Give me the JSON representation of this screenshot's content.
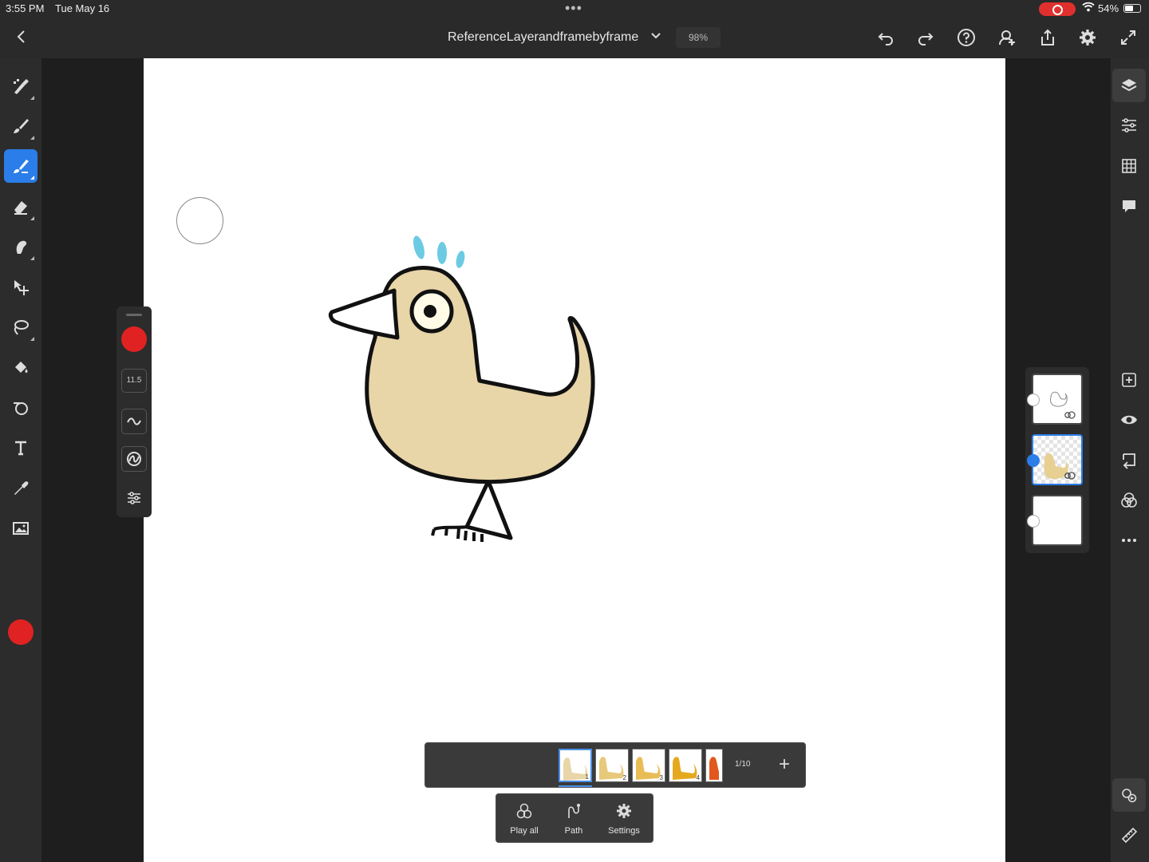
{
  "status_bar": {
    "time": "3:55 PM",
    "date": "Tue May 16",
    "battery": "54%"
  },
  "top_bar": {
    "document_title": "ReferenceLayerandframebyframe",
    "zoom": "98%",
    "icons": [
      "back-icon",
      "undo-icon",
      "redo-icon",
      "help-icon",
      "share-user-icon",
      "export-icon",
      "settings-icon",
      "fullscreen-icon"
    ]
  },
  "left_tools": {
    "items": [
      "pixel-brush",
      "live-brush",
      "vector-brush",
      "eraser",
      "smudge",
      "transform",
      "lasso-select",
      "fill",
      "liquify",
      "text",
      "eyedropper",
      "image"
    ],
    "active": "vector-brush",
    "current_color": "#e02222"
  },
  "brush_panel": {
    "size": "11.5",
    "color": "#e02222"
  },
  "right_tools": {
    "items": [
      "layers",
      "properties",
      "grid",
      "comments"
    ],
    "active": "layers",
    "layer_actions": [
      "add-layer",
      "visibility",
      "reference-layer",
      "blend-mode",
      "more"
    ],
    "bottom": [
      "animation",
      "ruler"
    ]
  },
  "layers": {
    "count": 3,
    "selected": 2
  },
  "timeline": {
    "frames": [
      "1",
      "2",
      "3",
      "4"
    ],
    "frame_counter": "1/10",
    "add_label": "+"
  },
  "animation_menu": {
    "play_all": "Play all",
    "path": "Path",
    "settings": "Settings"
  },
  "colors": {
    "accent": "#2b7de9",
    "bird_fill": "#e8d5a8",
    "crest": "#6ccbe3"
  }
}
